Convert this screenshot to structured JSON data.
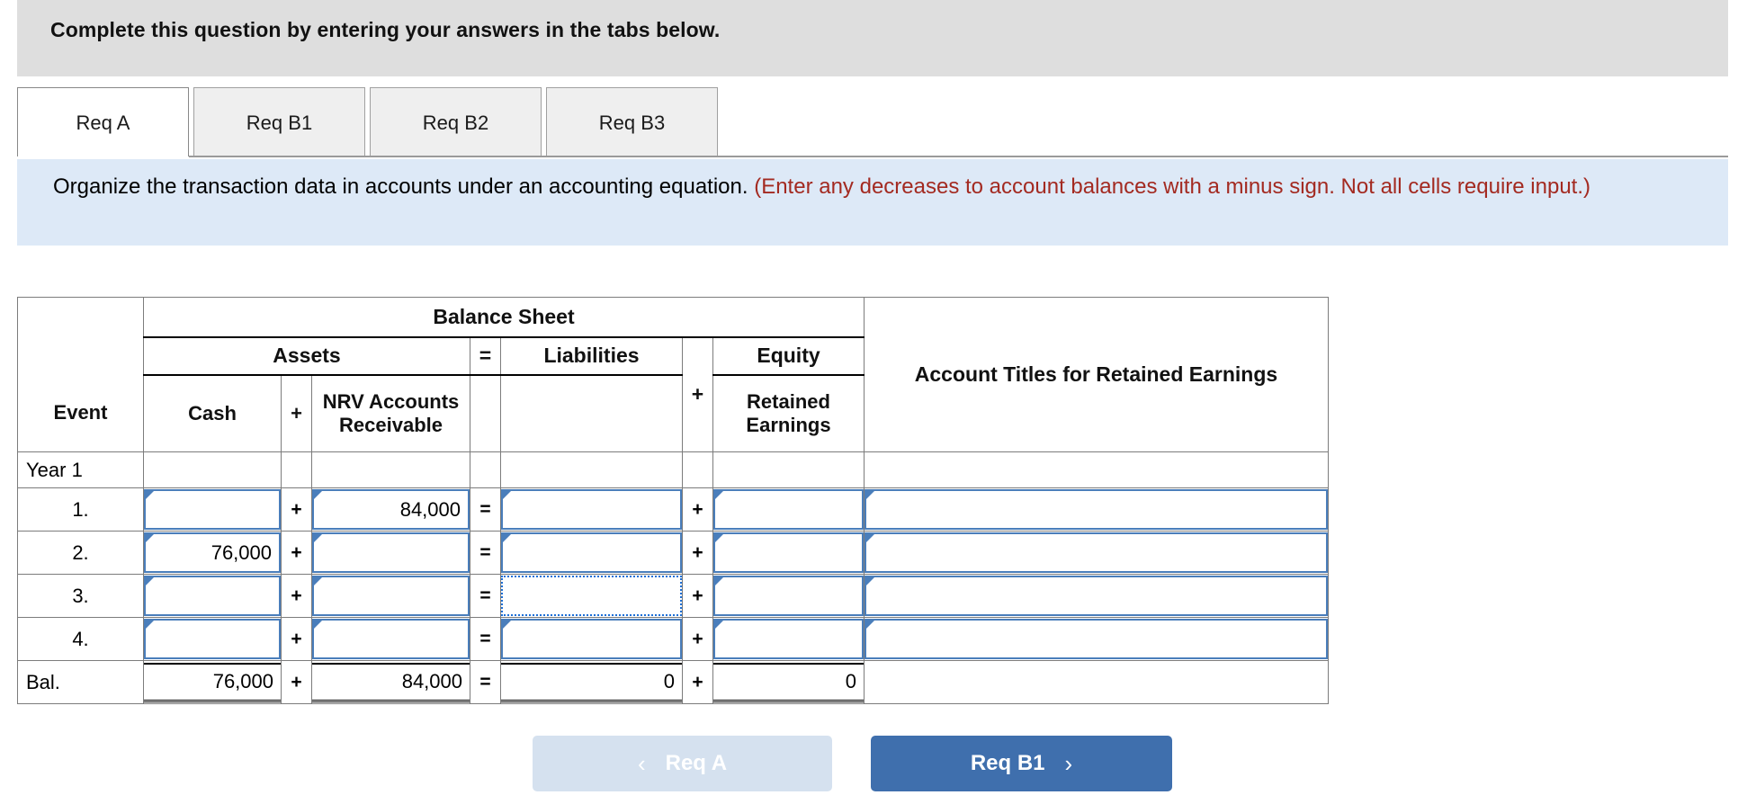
{
  "banner": {
    "title": "Complete this question by entering your answers in the tabs below."
  },
  "tabs": [
    {
      "id": "req-a",
      "label": "Req A",
      "active": true
    },
    {
      "id": "req-b1",
      "label": "Req B1",
      "active": false
    },
    {
      "id": "req-b2",
      "label": "Req B2",
      "active": false
    },
    {
      "id": "req-b3",
      "label": "Req B3",
      "active": false
    }
  ],
  "instruction": {
    "main": "Organize the transaction data in accounts under an accounting equation.",
    "note": "(Enter any decreases to account balances with a minus sign. Not all cells require input.)"
  },
  "table": {
    "headers": {
      "event": "Event",
      "balance_sheet": "Balance Sheet",
      "assets": "Assets",
      "equals": "=",
      "liabilities": "Liabilities",
      "plus": "+",
      "equity": "Equity",
      "cash": "Cash",
      "plus_assets": "+",
      "nrv_accounts_receivable": "NRV Accounts Receivable",
      "retained_earnings": "Retained Earnings",
      "account_titles": "Account Titles for Retained Earnings"
    },
    "section_label": "Year 1",
    "operators": {
      "plus": "+",
      "equals": "="
    },
    "rows": [
      {
        "label": "1.",
        "cash": "",
        "ar": "84,000",
        "liab": "",
        "re": "",
        "titles": "",
        "liab_focus": false
      },
      {
        "label": "2.",
        "cash": "76,000",
        "ar": "",
        "liab": "",
        "re": "",
        "titles": "",
        "liab_focus": false
      },
      {
        "label": "3.",
        "cash": "",
        "ar": "",
        "liab": "",
        "re": "",
        "titles": "",
        "liab_focus": true
      },
      {
        "label": "4.",
        "cash": "",
        "ar": "",
        "liab": "",
        "re": "",
        "titles": "",
        "liab_focus": false
      }
    ],
    "balance": {
      "label": "Bal.",
      "cash": "76,000",
      "ar": "84,000",
      "liab": "0",
      "re": "0",
      "titles": ""
    }
  },
  "footer": {
    "prev_label": "Req A",
    "prev_chevron": "‹",
    "next_label": "Req B1",
    "next_chevron": "›"
  },
  "colors": {
    "header_blue": "#88ade0",
    "instruction_bg": "#dde9f7",
    "banner_bg": "#dedede",
    "note_red": "#a32a21",
    "input_border": "#4a7ebb",
    "next_button": "#3f6fad",
    "prev_button": "#d5e1ef"
  }
}
